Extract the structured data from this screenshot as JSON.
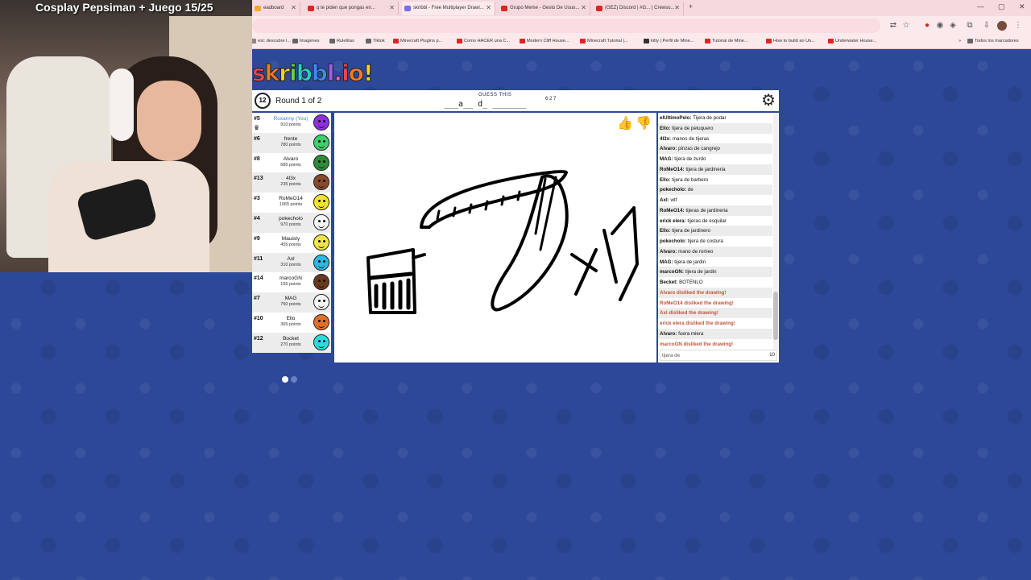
{
  "stream": {
    "title": "Cosplay Pepsiman + Juego 15/25"
  },
  "browser": {
    "tabs": [
      {
        "label": "eadboard",
        "icon_color": "#f5a623",
        "active": false
      },
      {
        "label": "q te piden que pongas en...",
        "icon_color": "#e02424",
        "active": false
      },
      {
        "label": "skribbl - Free Multiplayer Drawi...",
        "icon_color": "#7b6cf0",
        "active": true
      },
      {
        "label": "Grupo Meme - Gesto De Usuo...",
        "icon_color": "#e02424",
        "active": false
      },
      {
        "label": "(GEZ) Discord | #G... | Crewso...",
        "icon_color": "#e02424",
        "active": false
      }
    ],
    "new_tab": "+",
    "bookmarks": [
      {
        "label": "est: descubre l...",
        "color": "#888"
      },
      {
        "label": "Imagenes",
        "color": "#666"
      },
      {
        "label": "Ruletitas",
        "color": "#666"
      },
      {
        "label": "Tiktok",
        "color": "#666"
      },
      {
        "label": "Minecraft Plugins p...",
        "color": "#e02424"
      },
      {
        "label": "Como HACER una C...",
        "color": "#e02424"
      },
      {
        "label": "Modern Cliff House...",
        "color": "#e02424"
      },
      {
        "label": "Minecraft Tutorial |...",
        "color": "#e02424"
      },
      {
        "label": "kitty | Perfil de Mine...",
        "color": "#333"
      },
      {
        "label": "Tutorial de Mine...",
        "color": "#e02424"
      },
      {
        "label": "How to build an Un...",
        "color": "#e02424"
      },
      {
        "label": "Underwater House...",
        "color": "#e02424"
      },
      {
        "label": "»",
        "color": "#fce9ec"
      },
      {
        "label": "Todos los marcadores",
        "color": "#666"
      }
    ]
  },
  "game": {
    "logo_letters": [
      {
        "ch": "s",
        "color": "#f04848"
      },
      {
        "ch": "k",
        "color": "#f57a24"
      },
      {
        "ch": "r",
        "color": "#f7d51d"
      },
      {
        "ch": "i",
        "color": "#63d63b"
      },
      {
        "ch": "b",
        "color": "#1ed1c3"
      },
      {
        "ch": "b",
        "color": "#3e8bf0"
      },
      {
        "ch": "l",
        "color": "#a35ef0"
      },
      {
        "ch": ".",
        "color": "#f060c8"
      },
      {
        "ch": "i",
        "color": "#f04848"
      },
      {
        "ch": "o",
        "color": "#f57a24"
      },
      {
        "ch": "!",
        "color": "#f7d51d"
      }
    ],
    "timer": "12",
    "round": "Round 1 of 2",
    "guess_label": "GUESS THIS",
    "word_hint": "___a__ d_ _______",
    "word_lengths": "6 2 7",
    "settings_icon": "gear-icon",
    "players": [
      {
        "rank": "#5",
        "name": "Roxanny (You)",
        "points": "910 points",
        "color": "#8e2fe0",
        "you": true,
        "drawer": true
      },
      {
        "rank": "#6",
        "name": "frente",
        "points": "780 points",
        "color": "#3ed16a"
      },
      {
        "rank": "#8",
        "name": "Alvaro",
        "points": "685 points",
        "color": "#2e8b3a"
      },
      {
        "rank": "#13",
        "name": "4l3x",
        "points": "235 points",
        "color": "#8a4a2a"
      },
      {
        "rank": "#3",
        "name": "RoMeO14",
        "points": "1065 points",
        "color": "#f3e32a"
      },
      {
        "rank": "#4",
        "name": "pokecholo",
        "points": "970 points",
        "color": "#f5f5f5"
      },
      {
        "rank": "#9",
        "name": "Mauisty",
        "points": "455 points",
        "color": "#f0e64a"
      },
      {
        "rank": "#11",
        "name": "Axl",
        "points": "310 points",
        "color": "#2ab8e6"
      },
      {
        "rank": "#14",
        "name": "marcoGN",
        "points": "155 points",
        "color": "#6a3a1e"
      },
      {
        "rank": "#7",
        "name": "MAG",
        "points": "750 points",
        "color": "#f5f5f5"
      },
      {
        "rank": "#10",
        "name": "Ello",
        "points": "365 points",
        "color": "#e0702a"
      },
      {
        "rank": "#12",
        "name": "Bocket",
        "points": "270 points",
        "color": "#2adce0"
      }
    ],
    "chat": [
      {
        "who": "elUltimoPelo:",
        "text": "Tijera de podar"
      },
      {
        "who": "Ello:",
        "text": "tijera de peluquero"
      },
      {
        "who": "4l3x:",
        "text": "manos de tijeras"
      },
      {
        "who": "Alvaro:",
        "text": "pinzas de cangrejo"
      },
      {
        "who": "MAG:",
        "text": "tijera de zurdo"
      },
      {
        "who": "RoMeO14:",
        "text": "tijera de jardineria"
      },
      {
        "who": "Ello:",
        "text": "tijera de barbero"
      },
      {
        "who": "pokecholo:",
        "text": "de"
      },
      {
        "who": "Axl:",
        "text": "wtf"
      },
      {
        "who": "RoMeO14:",
        "text": "tijeras de jardineria"
      },
      {
        "who": "erick elera:",
        "text": "tijeras de esquilar"
      },
      {
        "who": "Ello:",
        "text": "tijera de jardinero"
      },
      {
        "who": "pokecholo:",
        "text": "tijera de costura"
      },
      {
        "who": "Alvaro:",
        "text": "mano de romeo"
      },
      {
        "who": "MAG:",
        "text": "tijera de jardin"
      },
      {
        "who": "marcoGN:",
        "text": "tijera de jardin"
      },
      {
        "who": "Becket:",
        "text": "BOTENLO"
      },
      {
        "who": "",
        "text": "Alvaro disliked the drawing!",
        "dislike": true
      },
      {
        "who": "",
        "text": "RoMeO14 disliked the drawing!",
        "dislike": true
      },
      {
        "who": "",
        "text": "Axl disliked the drawing!",
        "dislike": true
      },
      {
        "who": "",
        "text": "erick elera disliked the drawing!",
        "dislike": true
      },
      {
        "who": "Alvaro:",
        "text": "fuera miera"
      },
      {
        "who": "",
        "text": "marcoGN disliked the drawing!",
        "dislike": true
      }
    ],
    "chat_input_value": "tijera de",
    "chat_input_count": "10",
    "like_icon": "thumbs-up-icon",
    "dislike_icon": "thumbs-down-icon",
    "colors": {
      "like": "#5cb85c",
      "dislike": "#c0393b",
      "accent_bg": "#2d4898"
    }
  }
}
